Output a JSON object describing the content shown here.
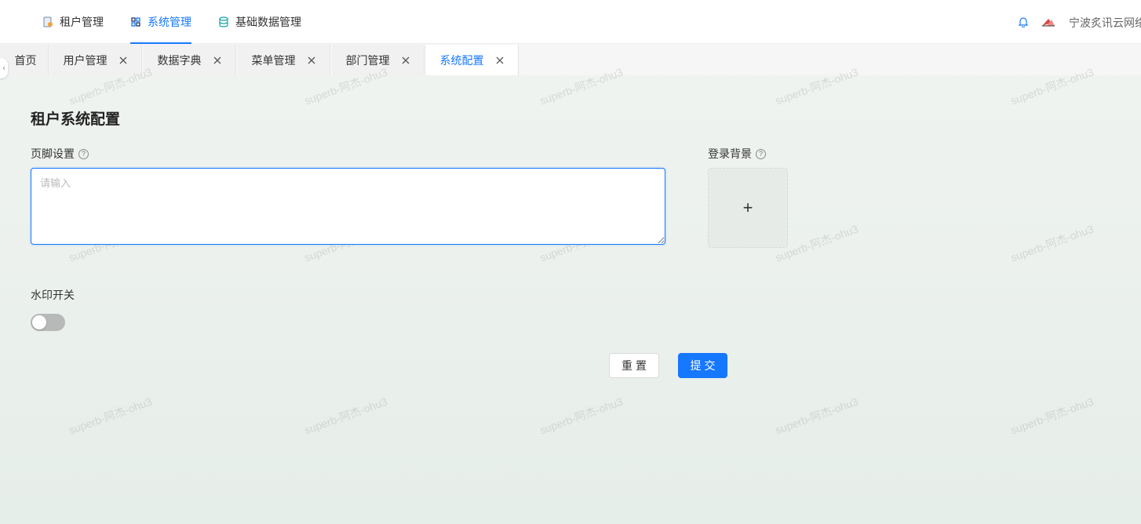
{
  "topnav": [
    {
      "label": "租户管理",
      "icon": "tenant-icon",
      "active": false
    },
    {
      "label": "系统管理",
      "icon": "system-icon",
      "active": true
    },
    {
      "label": "基础数据管理",
      "icon": "database-icon",
      "active": false
    }
  ],
  "header_right": {
    "tenant_name": "宁波炙讯云网络"
  },
  "tabs": [
    {
      "label": "首页",
      "closable": false
    },
    {
      "label": "用户管理",
      "closable": true
    },
    {
      "label": "数据字典",
      "closable": true
    },
    {
      "label": "菜单管理",
      "closable": true
    },
    {
      "label": "部门管理",
      "closable": true
    },
    {
      "label": "系统配置",
      "closable": true,
      "active": true
    }
  ],
  "watermark_text": "superb-阿杰-ohu3",
  "form": {
    "title": "租户系统配置",
    "footer_label": "页脚设置",
    "footer_placeholder": "请输入",
    "footer_value": "",
    "background_label": "登录背景",
    "upload_symbol": "+",
    "watermark_label": "水印开关",
    "watermark_enabled": false,
    "reset_label": "重置",
    "submit_label": "提交"
  },
  "colors": {
    "primary": "#1677ff",
    "switch_off": "#b6b9b7"
  }
}
